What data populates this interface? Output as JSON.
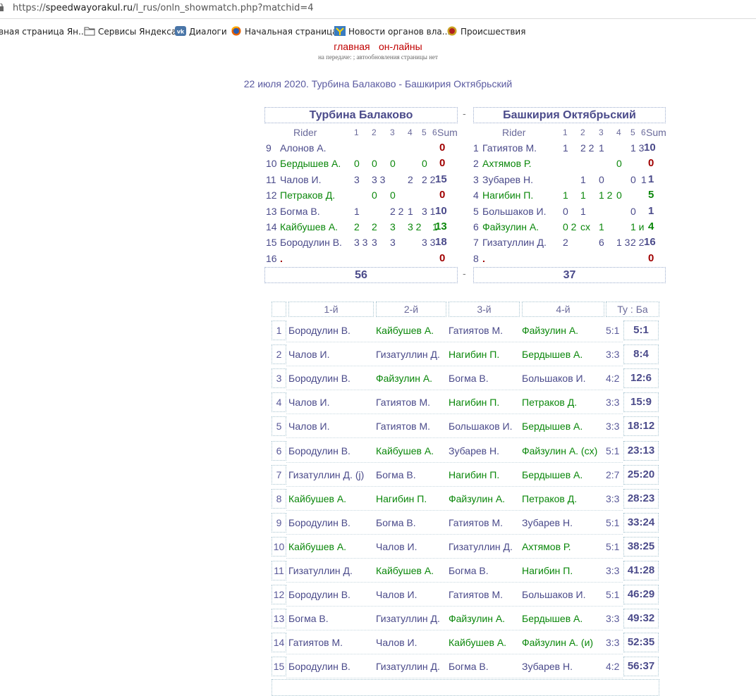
{
  "browser": {
    "url_scheme": "https://",
    "url_host": "speedwayorakul.ru",
    "url_path": "/l_rus/onln_showmatch.php?matchid=4",
    "bookmarks": [
      {
        "label": "вная страница Ян...",
        "icon": "page-icon"
      },
      {
        "label": "Сервисы Яндекса",
        "icon": "folder-icon"
      },
      {
        "label": "Диалоги",
        "icon": "vk-icon"
      },
      {
        "label": "Начальная страница",
        "icon": "firefox-icon"
      },
      {
        "label": "Новости органов вла...",
        "icon": "news-icon"
      },
      {
        "label": "Происшествия",
        "icon": "emblem-icon"
      }
    ]
  },
  "nav": {
    "home": "главная",
    "online": "он-лайны"
  },
  "subline": "на передаче: ;   автообновления страницы нет",
  "match_title": "22 июля 2020. Турбина Балаково - Башкирия Октябрьский",
  "teams": {
    "home": "Турбина Балаково",
    "away": "Башкирия Октябрьский",
    "separator": "-",
    "home_total": "56",
    "away_total": "37"
  },
  "rider_header": {
    "rider": "Rider",
    "h1": "1",
    "h2": "2",
    "h3": "3",
    "h4": "4",
    "h5": "5",
    "h6": "6",
    "sum": "Sum"
  },
  "home_riders": [
    {
      "no": "9",
      "name": "Алонов А.",
      "h": [
        "",
        "",
        "",
        "",
        "",
        ""
      ],
      "sum": "0",
      "color": "blue"
    },
    {
      "no": "10",
      "name": "Бердышев А.",
      "h": [
        "0",
        "0",
        "0",
        "",
        "0",
        ""
      ],
      "sum": "0",
      "color": "green"
    },
    {
      "no": "11",
      "name": "Чалов И.",
      "h": [
        "3",
        "3 3",
        "",
        "2",
        "2 2",
        ""
      ],
      "sum": "15",
      "color": "blue"
    },
    {
      "no": "12",
      "name": "Петраков Д.",
      "h": [
        "",
        "0",
        "0",
        "",
        "",
        ""
      ],
      "sum": "0",
      "color": "green"
    },
    {
      "no": "13",
      "name": "Богма В.",
      "h": [
        "1",
        "",
        "2 2",
        "1",
        "3 1",
        ""
      ],
      "sum": "10",
      "color": "blue"
    },
    {
      "no": "14",
      "name": "Кайбушев А.",
      "h": [
        "2",
        "2",
        "3",
        "3 2",
        "",
        "1"
      ],
      "sum": "13",
      "color": "green"
    },
    {
      "no": "15",
      "name": "Бородулин В.",
      "h": [
        "3 3",
        "3",
        "3",
        "",
        "3 3",
        ""
      ],
      "sum": "18",
      "color": "blue"
    },
    {
      "no": "16",
      "name": ".",
      "h": [
        "",
        "",
        "",
        "",
        "",
        ""
      ],
      "sum": "0",
      "color": "red"
    }
  ],
  "away_riders": [
    {
      "no": "1",
      "name": "Гатиятов М.",
      "h": [
        "1",
        "2 2",
        "1",
        "",
        "1 3",
        ""
      ],
      "sum": "10",
      "color": "blue"
    },
    {
      "no": "2",
      "name": "Ахтямов Р.",
      "h": [
        "",
        "",
        "",
        "0",
        "",
        ""
      ],
      "sum": "0",
      "color": "green"
    },
    {
      "no": "3",
      "name": "Зубарев Н.",
      "h": [
        "",
        "1",
        "0",
        "",
        "0",
        "1"
      ],
      "sum": "1",
      "color": "blue"
    },
    {
      "no": "4",
      "name": "Нагибин П.",
      "h": [
        "1",
        "1",
        "1 2",
        "0",
        "",
        ""
      ],
      "sum": "5",
      "color": "green"
    },
    {
      "no": "5",
      "name": "Большаков И.",
      "h": [
        "0",
        "1",
        "",
        "",
        "0",
        ""
      ],
      "sum": "1",
      "color": "blue"
    },
    {
      "no": "6",
      "name": "Файзулин А.",
      "h": [
        "0 2",
        "сх",
        "1",
        "",
        "1 и",
        ""
      ],
      "sum": "4",
      "color": "green"
    },
    {
      "no": "7",
      "name": "Гизатуллин Д.",
      "h": [
        "2",
        "",
        "6",
        "1 3",
        "2 2",
        ""
      ],
      "sum": "16",
      "color": "blue"
    },
    {
      "no": "8",
      "name": ".",
      "h": [
        "",
        "",
        "",
        "",
        "",
        ""
      ],
      "sum": "0",
      "color": "red"
    }
  ],
  "heats_header": {
    "g1": "1-й",
    "g2": "2-й",
    "g3": "3-й",
    "g4": "4-й",
    "score": "Ту : Ба"
  },
  "heats": [
    {
      "no": "1",
      "g": [
        "Бородулин В.",
        "Кайбушев А.",
        "Гатиятов М.",
        "Файзулин А."
      ],
      "gc": [
        "blue",
        "green",
        "blue",
        "green"
      ],
      "heat": "5:1",
      "total": "5:1"
    },
    {
      "no": "2",
      "g": [
        "Чалов И.",
        "Гизатуллин Д.",
        "Нагибин П.",
        "Бердышев А."
      ],
      "gc": [
        "blue",
        "blue",
        "green",
        "green"
      ],
      "heat": "3:3",
      "total": "8:4"
    },
    {
      "no": "3",
      "g": [
        "Бородулин В.",
        "Файзулин А.",
        "Богма В.",
        "Большаков И."
      ],
      "gc": [
        "blue",
        "green",
        "blue",
        "blue"
      ],
      "heat": "4:2",
      "total": "12:6"
    },
    {
      "no": "4",
      "g": [
        "Чалов И.",
        "Гатиятов М.",
        "Нагибин П.",
        "Петраков Д."
      ],
      "gc": [
        "blue",
        "blue",
        "green",
        "green"
      ],
      "heat": "3:3",
      "total": "15:9"
    },
    {
      "no": "5",
      "g": [
        "Чалов И.",
        "Гатиятов М.",
        "Большаков И.",
        "Бердышев А."
      ],
      "gc": [
        "blue",
        "blue",
        "blue",
        "green"
      ],
      "heat": "3:3",
      "total": "18:12"
    },
    {
      "no": "6",
      "g": [
        "Бородулин В.",
        "Кайбушев А.",
        "Зубарев Н.",
        "Файзулин А. (сх)"
      ],
      "gc": [
        "blue",
        "green",
        "blue",
        "green"
      ],
      "heat": "5:1",
      "total": "23:13"
    },
    {
      "no": "7",
      "g": [
        "Гизатуллин Д. (j)",
        "Богма В.",
        "Нагибин П.",
        "Бердышев А."
      ],
      "gc": [
        "blue",
        "blue",
        "green",
        "green"
      ],
      "heat": "2:7",
      "total": "25:20"
    },
    {
      "no": "8",
      "g": [
        "Кайбушев А.",
        "Нагибин П.",
        "Файзулин А.",
        "Петраков Д."
      ],
      "gc": [
        "green",
        "green",
        "green",
        "green"
      ],
      "heat": "3:3",
      "total": "28:23"
    },
    {
      "no": "9",
      "g": [
        "Бородулин В.",
        "Богма В.",
        "Гатиятов М.",
        "Зубарев Н."
      ],
      "gc": [
        "blue",
        "blue",
        "blue",
        "blue"
      ],
      "heat": "5:1",
      "total": "33:24"
    },
    {
      "no": "10",
      "g": [
        "Кайбушев А.",
        "Чалов И.",
        "Гизатуллин Д.",
        "Ахтямов Р."
      ],
      "gc": [
        "green",
        "blue",
        "blue",
        "green"
      ],
      "heat": "5:1",
      "total": "38:25"
    },
    {
      "no": "11",
      "g": [
        "Гизатуллин Д.",
        "Кайбушев А.",
        "Богма В.",
        "Нагибин П."
      ],
      "gc": [
        "blue",
        "green",
        "blue",
        "green"
      ],
      "heat": "3:3",
      "total": "41:28"
    },
    {
      "no": "12",
      "g": [
        "Бородулин В.",
        "Чалов И.",
        "Гатиятов М.",
        "Большаков И."
      ],
      "gc": [
        "blue",
        "blue",
        "blue",
        "blue"
      ],
      "heat": "5:1",
      "total": "46:29"
    },
    {
      "no": "13",
      "g": [
        "Богма В.",
        "Гизатуллин Д.",
        "Файзулин А.",
        "Бердышев А."
      ],
      "gc": [
        "blue",
        "blue",
        "green",
        "green"
      ],
      "heat": "3:3",
      "total": "49:32"
    },
    {
      "no": "14",
      "g": [
        "Гатиятов М.",
        "Чалов И.",
        "Кайбушев А.",
        "Файзулин А. (и)"
      ],
      "gc": [
        "blue",
        "blue",
        "green",
        "green"
      ],
      "heat": "3:3",
      "total": "52:35"
    },
    {
      "no": "15",
      "g": [
        "Бородулин В.",
        "Гизатуллин Д.",
        "Богма В.",
        "Зубарев Н."
      ],
      "gc": [
        "blue",
        "blue",
        "blue",
        "blue"
      ],
      "heat": "4:2",
      "total": "56:37"
    }
  ],
  "colors": {
    "blue": "#4a4a8a",
    "green": "#0a870a",
    "red": "#a00000",
    "link": "#c00000"
  }
}
